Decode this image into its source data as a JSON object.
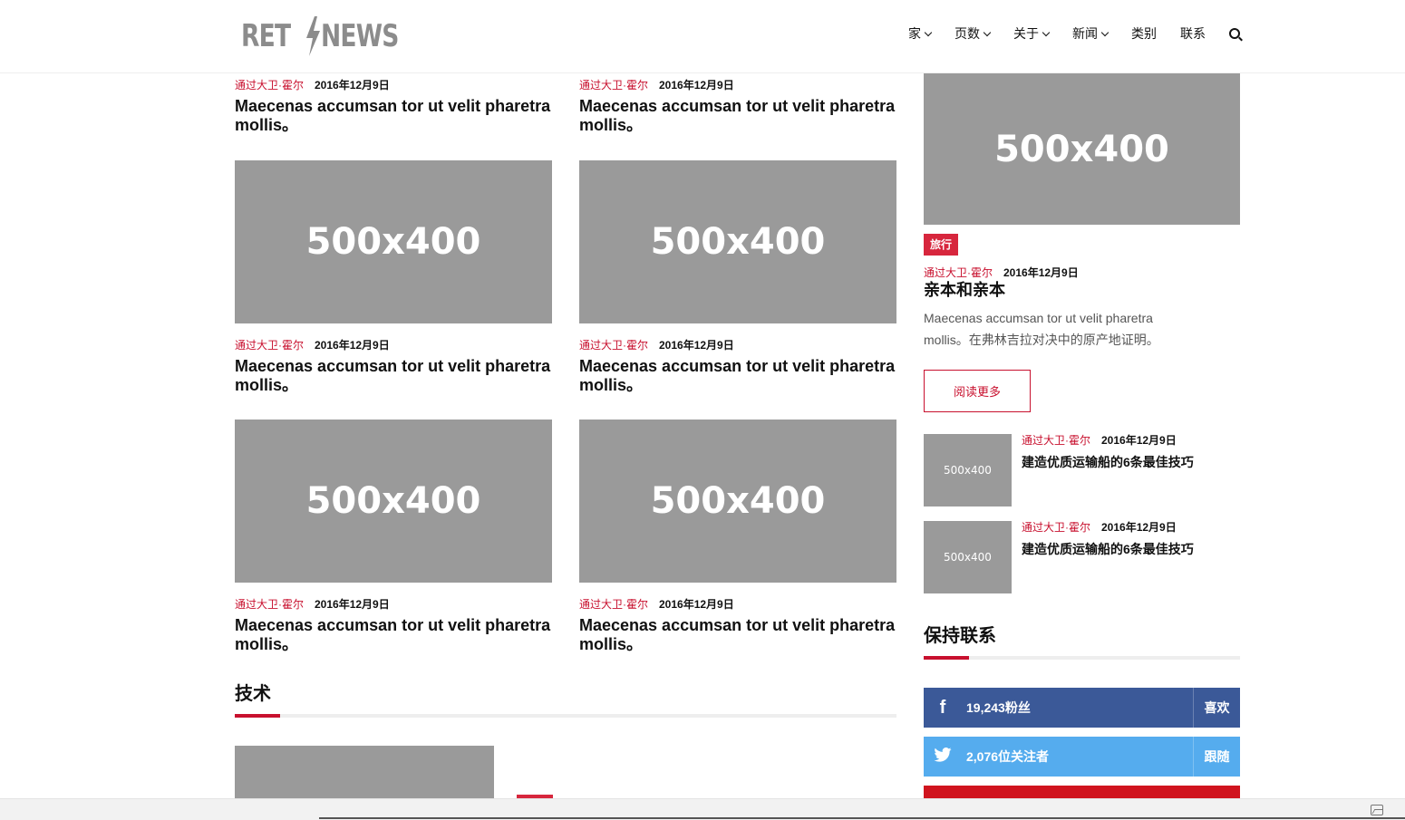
{
  "header": {
    "logo_left": "RET",
    "logo_right": "NEWS",
    "nav": [
      {
        "label": "家",
        "dropdown": true
      },
      {
        "label": "页数",
        "dropdown": true
      },
      {
        "label": "关于",
        "dropdown": true
      },
      {
        "label": "新闻",
        "dropdown": true
      },
      {
        "label": "类别",
        "dropdown": false
      },
      {
        "label": "联系",
        "dropdown": false
      }
    ]
  },
  "main": {
    "top_row": [
      {
        "author": "通过大卫·霍尔",
        "date": "2016年12月9日",
        "title": "Maecenas accumsan tor ut velit pharetra mollis。"
      },
      {
        "author": "通过大卫·霍尔",
        "date": "2016年12月9日",
        "title": "Maecenas accumsan tor ut velit pharetra mollis。"
      }
    ],
    "cards": [
      {
        "image": "500x400",
        "author": "通过大卫·霍尔",
        "date": "2016年12月9日",
        "title": "Maecenas accumsan tor ut velit pharetra mollis。"
      },
      {
        "image": "500x400",
        "author": "通过大卫·霍尔",
        "date": "2016年12月9日",
        "title": "Maecenas accumsan tor ut velit pharetra mollis。"
      },
      {
        "image": "500x400",
        "author": "通过大卫·霍尔",
        "date": "2016年12月9日",
        "title": "Maecenas accumsan tor ut velit pharetra mollis。"
      },
      {
        "image": "500x400",
        "author": "通过大卫·霍尔",
        "date": "2016年12月9日",
        "title": "Maecenas accumsan tor ut velit pharetra mollis。"
      }
    ],
    "tech_section": {
      "title": "技术"
    }
  },
  "sidebar": {
    "featured": {
      "image": "500x400",
      "tag": "旅行",
      "author": "通过大卫·霍尔",
      "date": "2016年12月9日",
      "title": "亲本和亲本",
      "excerpt_line1": "Maecenas accumsan tor ut velit pharetra",
      "excerpt_line2": "mollis。在弗林吉拉对决中的原产地证明。",
      "read_more": "阅读更多"
    },
    "small_posts": [
      {
        "image": "500x400",
        "author": "通过大卫·霍尔",
        "date": "2016年12月9日",
        "title": "建造优质运输船的6条最佳技巧"
      },
      {
        "image": "500x400",
        "author": "通过大卫·霍尔",
        "date": "2016年12月9日",
        "title": "建造优质运输船的6条最佳技巧"
      }
    ],
    "stay_connected": {
      "title": "保持联系",
      "facebook": {
        "icon": "f",
        "count": "19,243粉丝",
        "action": "喜欢",
        "color": "#3b5998"
      },
      "twitter": {
        "icon": "t",
        "count": "2,076位关注者",
        "action": "跟随",
        "color": "#55acee"
      },
      "youtube": {
        "color": "#d0141e"
      }
    }
  },
  "colors": {
    "accent": "#c8102e",
    "placeholder": "#9a9a9a"
  }
}
